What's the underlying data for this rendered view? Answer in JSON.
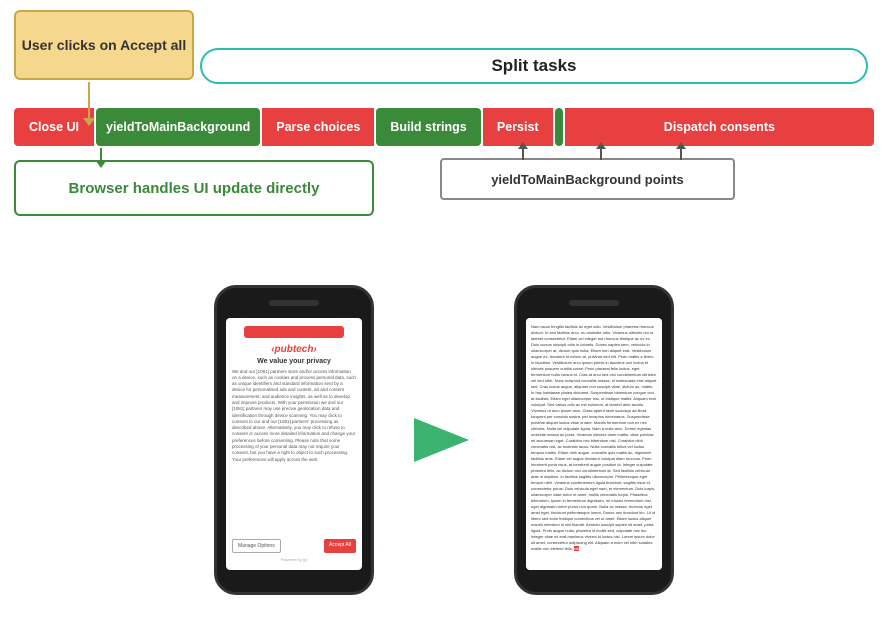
{
  "userClicks": {
    "label": "User clicks on Accept all"
  },
  "splitTasks": {
    "label": "Split tasks"
  },
  "pipeline": {
    "closeUI": "Close UI",
    "yield1": "yieldToMainBackground",
    "parse": "Parse choices",
    "build": "Build strings",
    "persist": "Persist",
    "dispatch": "Dispatch consents"
  },
  "browser": {
    "label": "Browser handles UI update directly"
  },
  "yieldPoints": {
    "label": "yieldToMainBackground  points"
  },
  "pubtech": {
    "name": "‹pubtech›",
    "subtitle": "We value your privacy",
    "body": "We and our [1081] partners store and/or access information on a device, such as cookies and process personal data, such as unique identifiers and standard information sent by a device for personalised ads and content, ad and content measurement, and audience insights, as well as to develop and improve products. With your permission we and our [1081] partners may use precise geolocation data and identification through device scanning. You may click to consent to our and our [1081] partners' processing as described above. Alternatively, you may click to refuse to consent or access more detailed information and change your preferences before consenting. Please note that some processing of your personal data may not require your consent, but you have a right to object to such processing. Your preferences will apply across the web.",
    "manageOptions": "Manage Options",
    "acceptAll": "Accept All",
    "footer": "Powered by [p]"
  },
  "articleText": "Nam lacus fringilla facilisis ac eget odio. Vestibulum pharetra rhoncus dictum. In sed facilisis arcu, eu molestie odio. Vivamus ultricies dui ut laoreet consectetur. Etiam vel integer est rhoncus tristique ac ex ex. Duis cursus suscipit odio in lobortis. Donec sapien sem, vehicula in ullamcorper at, dictum quis nulla. Etiam non aliquet erat. Vestibulum augue ex, tincidunt id rutrum at, pulvinar sed elit. Proin mattis a libero in faucibus. Vestibulum arcu ipsum primis in faucibus orci luctus et ultrices posuere cubilia curae; Proin placerat felis luctus, eget fermentum nulla cursus id. Cras at arcu sed orci condimentum ultricies vel sed nibh. Nunc euismod convallis massa, id malesuada erat aliquet sed. Cras luctus augue, aliquam non suscipit vitae, dictum ac, mattis. In hac habitasse platea dictumst. Suspendisse bibendum congue orci at facilisis. Etiam eget ullamcorper nisl, ut tristique mattis. Aliquam erat volutpat. Sed varius odio ac est euismod, at laoreet ante iaculis. Vivamus ut arcu ipsum arcu. Class aptent taciti sociosqu ad litora torquent per conubia nostra, per inceptos himenaeos. Suspendisse pulvinar aliquet luctus vitae ornare. Mauris fermentum non ex nec ultricies. Nulla vel vulputate ligula. Nam a nulla arcu. Donec egestas molestie massa ac porta. Vivamus ultricies diam mattis, vitae pulvinar mi accumsan eget. Curabitur nec bibendum nisl. Curabitur nibh venenatis nisl, ac molestie lacus. Nulla convallis tellus vel luctus tempus mattis. Etiam nibh augue, convallis quis mattis ac, dignissim facilisis ante. Etiam vel augue tincidunt volutpat diam rhoncus. Proin hendrerit porta risus, at hendrerit augue position ut. Integer vulputate pharetra felis, ac dictum orci condimentum at. Sed facilisis vehicula ante in dapibus. In facilisis sagittis ullamcorper. Pellentesque eget tempor nibh. Vivamus condimentum ligula tincidunt, sagittis risus et, consectetur purus. Duis vehicula eget nam, et elementum. Duis turpis, ullamcorper vitae tortor ut amet, mollis venenatis turpis. Phasellus bibendum, ipsum in fermentum dignissim, mi mauris fermentum nisi, eget dignissim tortor purus non quam. Nulla ac massa, rhoncus eget amet eget, tincidunt pellentesque lorem. Donec nec tincidunt leo. Ut id libero sed enim tristique comenibus vel ut amet. Etiam luctus aliquet mauris interdum id nisl blandit. Aenean suscipit sapien sit amet, porta ligula. Proin augue nulla, pharetra id mollis sed, vulputate nec leo. Integer vitae mi erat maximus viverra id luctus nisl. Lorem ipsum dolor sit amet, consectetur adipiscing elit. Aliquam a enim vel nibh sodales mattis non eleiend felis."
}
